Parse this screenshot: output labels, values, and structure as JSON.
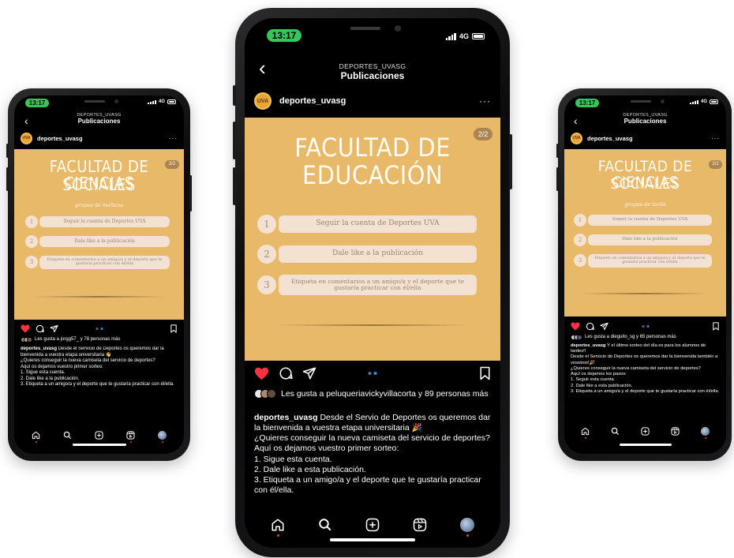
{
  "phones": {
    "left": {
      "time": "13:17",
      "network": "4G",
      "header_sub": "DEPORTES_UVASG",
      "header_title": "Publicaciones",
      "account": "deportes_uvasg",
      "post_heading_1": "FACULTAD DE CIENCIAS",
      "post_heading_2": "SOCIALES",
      "post_script": "grupos de mañana",
      "counter": "2/2",
      "steps": [
        "Seguir la cuenta de Deportes UVA",
        "Dale like a la publicación",
        "Etiqueta en comentarios a un amigo/a y el deporte que te gustaría practicar con él/ella"
      ],
      "likes_text": "Les gusta a jorgg57_ y 78 personas más",
      "caption_user": "deportes_uvasg",
      "caption_first": "Desde el Servicio de Deportes os queremos dar la bienvenida a vuestra etapa universitaria 👋",
      "caption_rest": "¿Quieres conseguir la nueva camiseta del servicio de deportes?\nAquí os dejamos vuestro primer sorteo:\n1. Sigue esta cuenta.\n2. Dale like a la publicación.\n3. Etiqueta a un amigo/a y el deporte que te gustaría practicar con él/ella."
    },
    "center": {
      "time": "13:17",
      "network": "4G",
      "header_sub": "DEPORTES_UVASG",
      "header_title": "Publicaciones",
      "account": "deportes_uvasg",
      "post_heading_1": "FACULTAD DE",
      "post_heading_2": "EDUCACIÓN",
      "counter": "2/2",
      "steps": [
        "Seguir la cuenta de Deportes UVA",
        "Dale like a la publicación",
        "Etiqueta en comentarios a un amigo/a y el deporte que te gustaría practicar con él/ella"
      ],
      "likes_text": "Les gusta a peluqueriavickyvillacorta y 89 personas más",
      "caption_user": "deportes_uvasg",
      "caption_first": "Desde el Servio de Deportes os queremos dar la bienvenida a vuestra etapa universitaria 🎉",
      "caption_rest": "¿Quieres conseguir la nueva camiseta del servicio de deportes?\nAquí os dejamos vuestro primer sorteo:\n1. Sigue esta cuenta.\n2. Dale like a esta publicación.\n3. Etiqueta a un amigo/a y el deporte que te gustaría practicar con él/ella."
    },
    "right": {
      "time": "13:17",
      "network": "4G",
      "header_sub": "DEPORTES_UVASG",
      "header_title": "Publicaciones",
      "account": "deportes_uvasg",
      "post_heading_1": "FACULTAD DE CIENCIAS",
      "post_heading_2": "SOCIALES",
      "post_script": "grupos de tarde",
      "counter": "2/2",
      "steps": [
        "Seguir la cuenta de Deportes UVA",
        "Dale like a la publicación",
        "Etiqueta en comentarios a un amigo/a y el deporte que te gustaría practicar con él/ella"
      ],
      "likes_text": "Les gusta a dieguito_sg y 65 personas más",
      "caption_user": "deportes_uvasg",
      "caption_first": "Y el último sorteo del día es para los alumnos de tardes!!",
      "caption_rest": "Desde el Servicio de Deportes os queremos dar la bienvenida también a vosotros!🎉\n¿Quieres conseguir la nueva camiseta del servicio de deportes?\nAquí os dejamos los pasos:\n1. Seguir esta cuenta\n2. Dale like a esta publicación.\n3. Etiqueta a un amigo/a y el deporte que te gustaría practicar con él/ella."
    }
  },
  "colors": {
    "post_bg": "#e9b96a",
    "time_pill": "#34c759",
    "like_red": "#ff3040",
    "carousel_dot": "#2f86e5"
  },
  "icons": [
    "back-chevron-icon",
    "more-icon",
    "heart-icon",
    "comment-icon",
    "share-icon",
    "bookmark-icon",
    "home-icon",
    "search-icon",
    "new-post-icon",
    "reels-icon",
    "profile-icon"
  ]
}
